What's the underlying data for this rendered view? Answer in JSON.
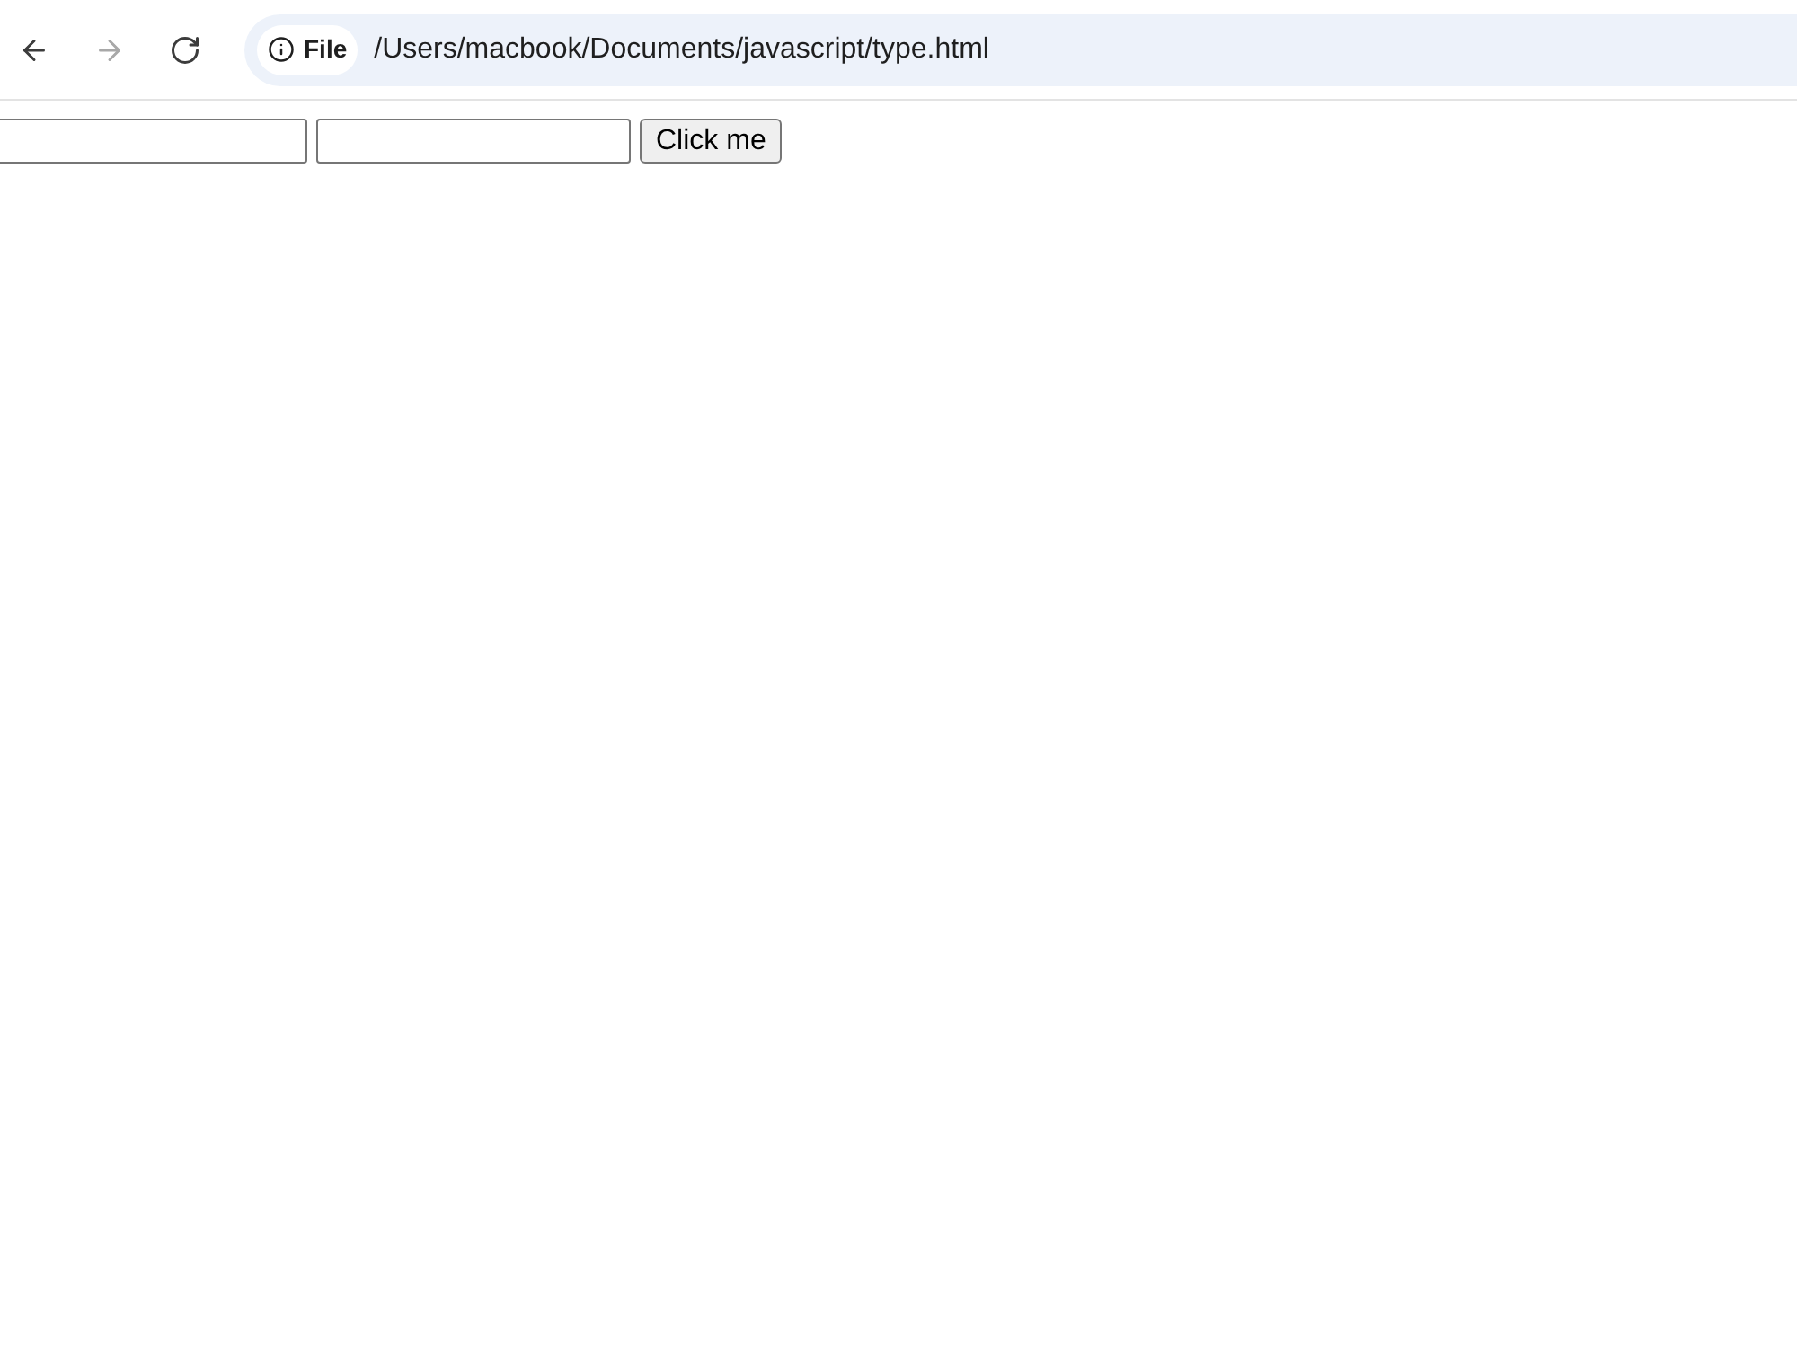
{
  "toolbar": {
    "buttons": [
      {
        "kind": "back",
        "disabled": false
      },
      {
        "kind": "forward",
        "disabled": true
      },
      {
        "kind": "reload",
        "disabled": false
      }
    ]
  },
  "address_bar": {
    "chip": {
      "label": "File"
    },
    "url": "/Users/macbook/Documents/javascript/type.html"
  },
  "page": {
    "controls": [
      {
        "kind": "input"
      },
      {
        "kind": "input"
      },
      {
        "kind": "button",
        "label": "Click me"
      }
    ]
  }
}
